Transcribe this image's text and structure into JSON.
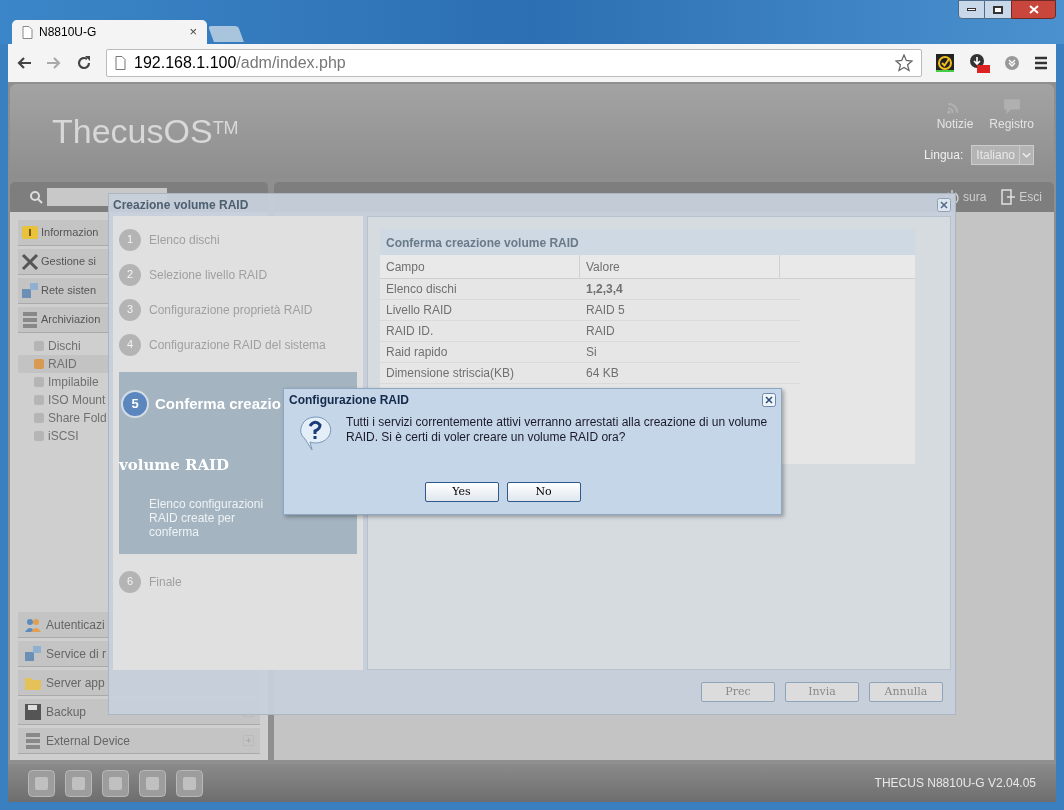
{
  "browser": {
    "tabs": [
      {
        "title": "N8810U-G",
        "close": "×",
        "selected": true
      }
    ],
    "address": {
      "host": "192.168.1.100",
      "path": "/adm/index.php"
    }
  },
  "header": {
    "logo": "ThecusOS",
    "logo_mark": "TM",
    "links": [
      {
        "label": "Notizie",
        "kind": "rss"
      },
      {
        "label": "Registro",
        "kind": "chat"
      }
    ],
    "language_label": "Lingua:",
    "language_value": "Italiano"
  },
  "toolbar": [
    {
      "label": "sura",
      "kind": "power"
    },
    {
      "label": "Esci",
      "kind": "exit"
    }
  ],
  "sidebar": {
    "groups": [
      {
        "label": "Informazion",
        "kind": "info"
      },
      {
        "label": "Gestione si",
        "kind": "tools"
      },
      {
        "label": "Rete sisten",
        "kind": "network"
      },
      {
        "label": "Archiviazion",
        "kind": "storage",
        "children": [
          {
            "label": "Dischi",
            "selected": false
          },
          {
            "label": "RAID",
            "selected": true
          },
          {
            "label": "Impilabile",
            "selected": false
          },
          {
            "label": "ISO Mount",
            "selected": false
          },
          {
            "label": "Share Fold",
            "selected": false
          },
          {
            "label": "iSCSI",
            "selected": false
          }
        ]
      }
    ],
    "bottom_groups": [
      {
        "label": "Autenticazi",
        "kind": "user"
      },
      {
        "label": "Service di r",
        "kind": "network"
      },
      {
        "label": "Server app",
        "kind": "folder"
      },
      {
        "label": "Backup",
        "kind": "disk"
      },
      {
        "label": "External Device",
        "kind": "storage"
      }
    ]
  },
  "status_bar": {
    "version": "THECUS N8810U-G V2.04.05"
  },
  "wizard": {
    "title": "Creazione volume RAID",
    "steps": [
      {
        "number": "1",
        "title_lines": [
          "Elenco dischi"
        ],
        "selected": false
      },
      {
        "number": "2",
        "title_lines": [
          "Selezione livello RAID"
        ],
        "selected": false
      },
      {
        "number": "3",
        "title_lines": [
          "Configurazione proprietà RAID"
        ],
        "selected": false
      },
      {
        "number": "4",
        "title_lines": [
          "Configurazione RAID del sistema"
        ],
        "selected": false
      },
      {
        "number": "5",
        "title_lines": [
          "Conferma creazio",
          "volume RAID"
        ],
        "description": "Elenco configurazioni RAID create per conferma",
        "selected": true
      },
      {
        "number": "6",
        "title_lines": [
          "Finale"
        ],
        "selected": false
      }
    ],
    "panel_title": "Conferma creazione volume RAID",
    "table": {
      "columns": [
        "Campo",
        "Valore"
      ],
      "rows": [
        {
          "field": "Elenco dischi",
          "value": "1,2,3,4",
          "bold": true
        },
        {
          "field": "Livello RAID",
          "value": "RAID 5",
          "bold": false
        },
        {
          "field": "RAID ID.",
          "value": "RAID",
          "bold": false
        },
        {
          "field": "Raid rapido",
          "value": "Si",
          "bold": false
        },
        {
          "field": "Dimensione striscia(KB)",
          "value": "64 KB",
          "bold": false
        }
      ]
    },
    "buttons": [
      "Prec",
      "Invia",
      "Annulla"
    ]
  },
  "confirm": {
    "title": "Configurazione RAID",
    "message": "Tutti i servizi correntemente attivi verranno arrestati alla creazione di un volume RAID. Si è certi di voler creare un volume RAID ora?",
    "buttons": [
      "Yes",
      "No"
    ]
  }
}
